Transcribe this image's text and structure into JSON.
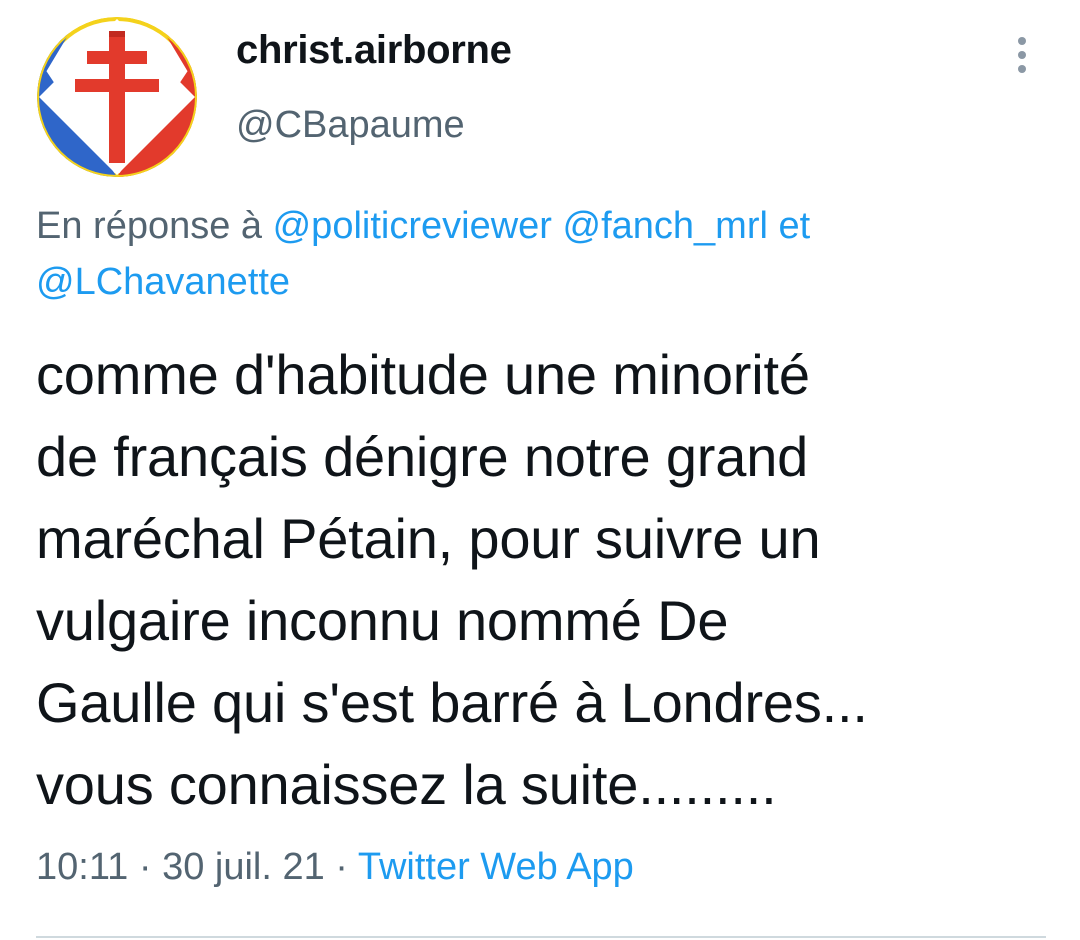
{
  "author": {
    "display_name": "christ.airborne",
    "handle": "@CBapaume",
    "avatar_icon": "cross-of-lorraine-tricolor-avatar"
  },
  "reply": {
    "prefix": "En réponse à ",
    "mention_1": "@politicreviewer",
    "mention_2": "@fanch_mrl",
    "conjunction": " et ",
    "mention_3": "@LChavanette"
  },
  "tweet": {
    "lines": [
      "comme d'habitude une minorité",
      "de français dénigre notre grand",
      "maréchal Pétain, pour suivre un",
      "vulgaire inconnu nommé De",
      "Gaulle qui s'est barré à Londres...",
      "vous connaissez la suite........."
    ]
  },
  "meta": {
    "time": "10:11",
    "separator": " · ",
    "date": "30 juil. 21",
    "source": "Twitter Web App"
  },
  "colors": {
    "text": "#0f1419",
    "secondary": "#536471",
    "link": "#1d9bf0",
    "avatar_blue": "#2f66c9",
    "avatar_red": "#e23a2c",
    "avatar_yellow": "#f4d21c"
  }
}
